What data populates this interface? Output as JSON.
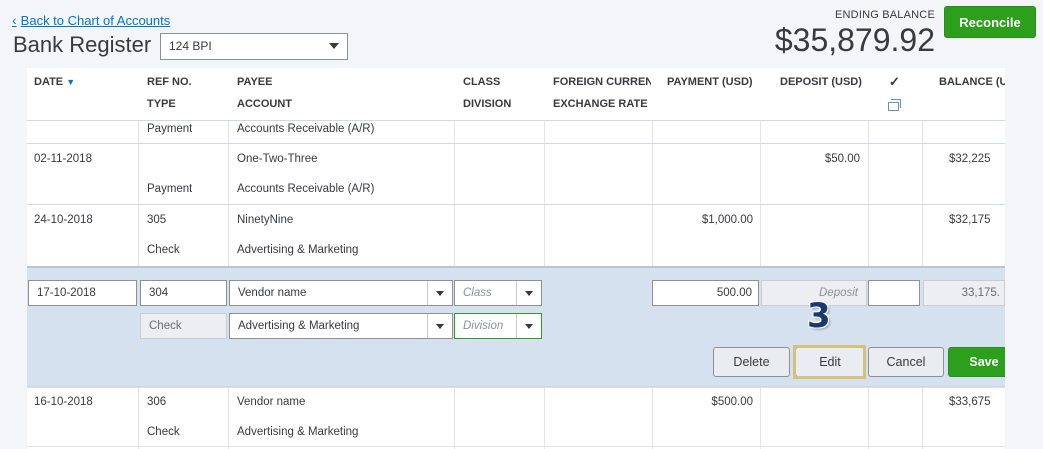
{
  "nav": {
    "back_label": "Back to Chart of Accounts"
  },
  "page": {
    "title": "Bank Register",
    "account_select": "124 BPI"
  },
  "summary": {
    "ending_label": "ENDING BALANCE",
    "ending_amount": "$35,879.92",
    "reconcile_label": "Reconcile"
  },
  "columns": {
    "date": "DATE",
    "ref": "REF NO.",
    "type": "TYPE",
    "payee": "PAYEE",
    "account": "ACCOUNT",
    "class": "CLASS",
    "division": "DIVISION",
    "fx": "FOREIGN CURRENCY",
    "exrate": "EXCHANGE RATE",
    "payment": "PAYMENT (USD)",
    "deposit": "DEPOSIT (USD)",
    "check": "✓",
    "balance": "BALANCE (USD)"
  },
  "rows": [
    {
      "date": "",
      "ref": "",
      "type": "Payment",
      "payee": "",
      "account": "Accounts Receivable (A/R)",
      "payment": "",
      "deposit": "",
      "balance": ""
    },
    {
      "date": "02-11-2018",
      "ref": "",
      "type": "Payment",
      "payee": "One-Two-Three",
      "account": "Accounts Receivable (A/R)",
      "payment": "",
      "deposit": "$50.00",
      "balance": "$32,225"
    },
    {
      "date": "24-10-2018",
      "ref": "305",
      "type": "Check",
      "payee": "NinetyNine",
      "account": "Advertising & Marketing",
      "payment": "$1,000.00",
      "deposit": "",
      "balance": "$32,175"
    },
    {
      "date": "16-10-2018",
      "ref": "306",
      "type": "Check",
      "payee": "Vendor name",
      "account": "Advertising & Marketing",
      "payment": "$500.00",
      "deposit": "",
      "balance": "$33,675"
    }
  ],
  "edit": {
    "date": "17-10-2018",
    "ref": "304",
    "type": "Check",
    "payee": "Vendor name",
    "account": "Advertising & Marketing",
    "class_placeholder": "Class",
    "division_placeholder": "Division",
    "payment": "500.00",
    "deposit_placeholder": "Deposit",
    "balance": "33,175.",
    "delete_label": "Delete",
    "edit_label": "Edit",
    "cancel_label": "Cancel",
    "save_label": "Save"
  },
  "annotation": {
    "step_number": "3",
    "highlight_color": "#d6c07a"
  },
  "colors": {
    "accent_green": "#2ca01c",
    "link_blue": "#0077c5",
    "edit_band": "#d6e1ef"
  }
}
